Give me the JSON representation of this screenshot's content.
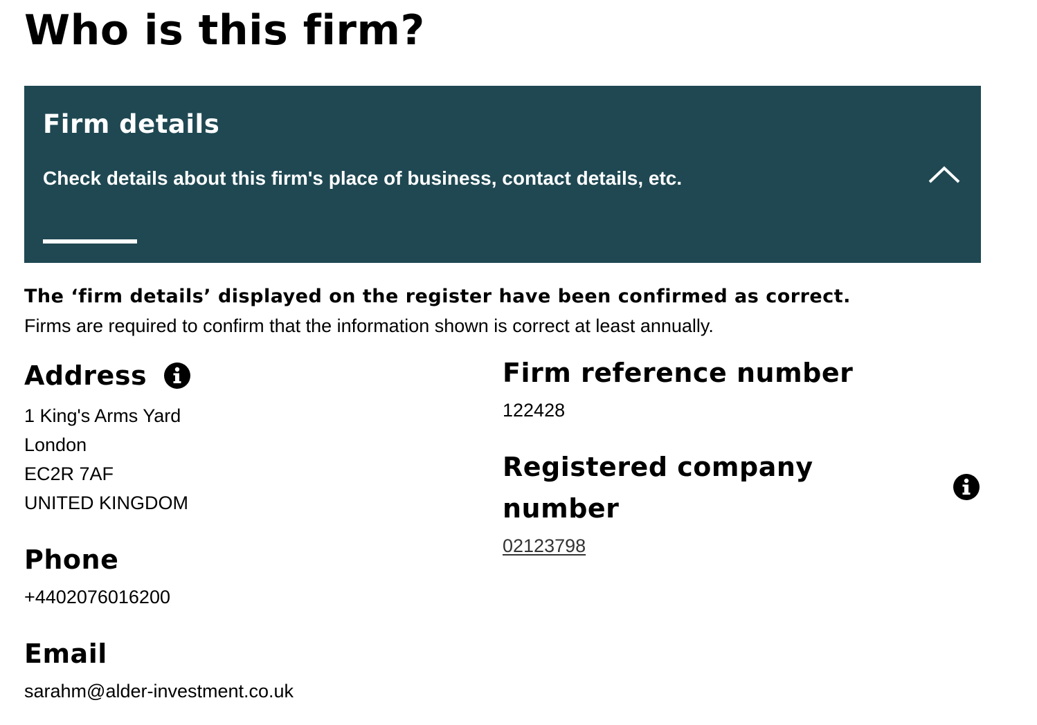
{
  "page": {
    "title": "Who is this firm?"
  },
  "panel": {
    "title": "Firm details",
    "description": "Check details about this firm's place of business, contact details, etc.",
    "toggle_icon": "chevron-up-icon",
    "background_color": "#1f4852"
  },
  "confirmation": {
    "strong": "The ‘firm details’ displayed on the register have been confirmed as correct.",
    "note": "Firms are required to confirm that the information shown is correct at least annually."
  },
  "address": {
    "label": "Address",
    "info_icon": "info-icon",
    "lines": [
      "1 King's Arms Yard",
      "London",
      "EC2R 7AF",
      "UNITED KINGDOM"
    ]
  },
  "phone": {
    "label": "Phone",
    "value": "+4402076016200"
  },
  "email": {
    "label": "Email",
    "value": "sarahm@alder-investment.co.uk"
  },
  "frn": {
    "label": "Firm reference number",
    "value": "122428"
  },
  "company_number": {
    "label_line1": "Registered company",
    "label_line2": "number",
    "info_icon": "info-icon",
    "value": "02123798"
  }
}
